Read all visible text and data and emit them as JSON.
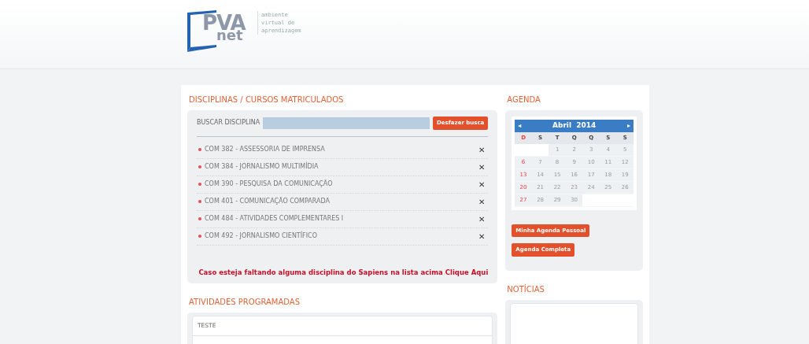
{
  "logo": {
    "mark": "PVA",
    "sub": "net",
    "tagline": [
      "ambiente",
      "virtual de",
      "aprendizagem"
    ]
  },
  "courses": {
    "title": "DISCIPLINAS / CURSOS MATRICULADOS",
    "search_label": "BUSCAR DISCIPLINA",
    "search_button": "Desfazer busca",
    "items": [
      {
        "label": "COM 382 - ASSESSORIA DE IMPRENSA",
        "remove": "✕"
      },
      {
        "label": "COM 384 - JORNALISMO MULTIMÍDIA",
        "remove": "✕"
      },
      {
        "label": "COM 390 - PESQUISA DA COMUNICAÇÃO",
        "remove": "✕"
      },
      {
        "label": "COM 401 - COMUNICAÇÃO COMPARADA",
        "remove": "✕"
      },
      {
        "label": "COM 484 - ATIVIDADES COMPLEMENTARES I",
        "remove": "✕"
      },
      {
        "label": "COM 492 - JORNALISMO CIENTÍFICO",
        "remove": "✕"
      }
    ],
    "missing_notice": "Caso esteja faltando alguma disciplina do Sapiens na lista acima Clique Aqui"
  },
  "activities": {
    "title": "ATIVIDADES PROGRAMADAS",
    "items": [
      "TESTE"
    ]
  },
  "agenda": {
    "title": "AGENDA",
    "month": "Abril",
    "year": "2014",
    "prev": "◂",
    "next": "▸",
    "weekdays": [
      "D",
      "S",
      "T",
      "Q",
      "Q",
      "S",
      "S"
    ],
    "weeks": [
      {
        "right_aligned": true,
        "days": [
          "1",
          "2",
          "3",
          "4",
          "5"
        ]
      },
      {
        "right_aligned": false,
        "days": [
          "6",
          "7",
          "8",
          "9",
          "10",
          "11",
          "12"
        ]
      },
      {
        "right_aligned": false,
        "days": [
          "13",
          "14",
          "15",
          "16",
          "17",
          "18",
          "19"
        ]
      },
      {
        "right_aligned": false,
        "days": [
          "20",
          "21",
          "22",
          "23",
          "24",
          "25",
          "26"
        ]
      },
      {
        "right_aligned": false,
        "days": [
          "27",
          "28",
          "29",
          "30"
        ]
      }
    ],
    "buttons": [
      "Minha Agenda Pessoal",
      "Agenda Completa"
    ]
  },
  "news": {
    "title": "NOTÍCIAS"
  }
}
